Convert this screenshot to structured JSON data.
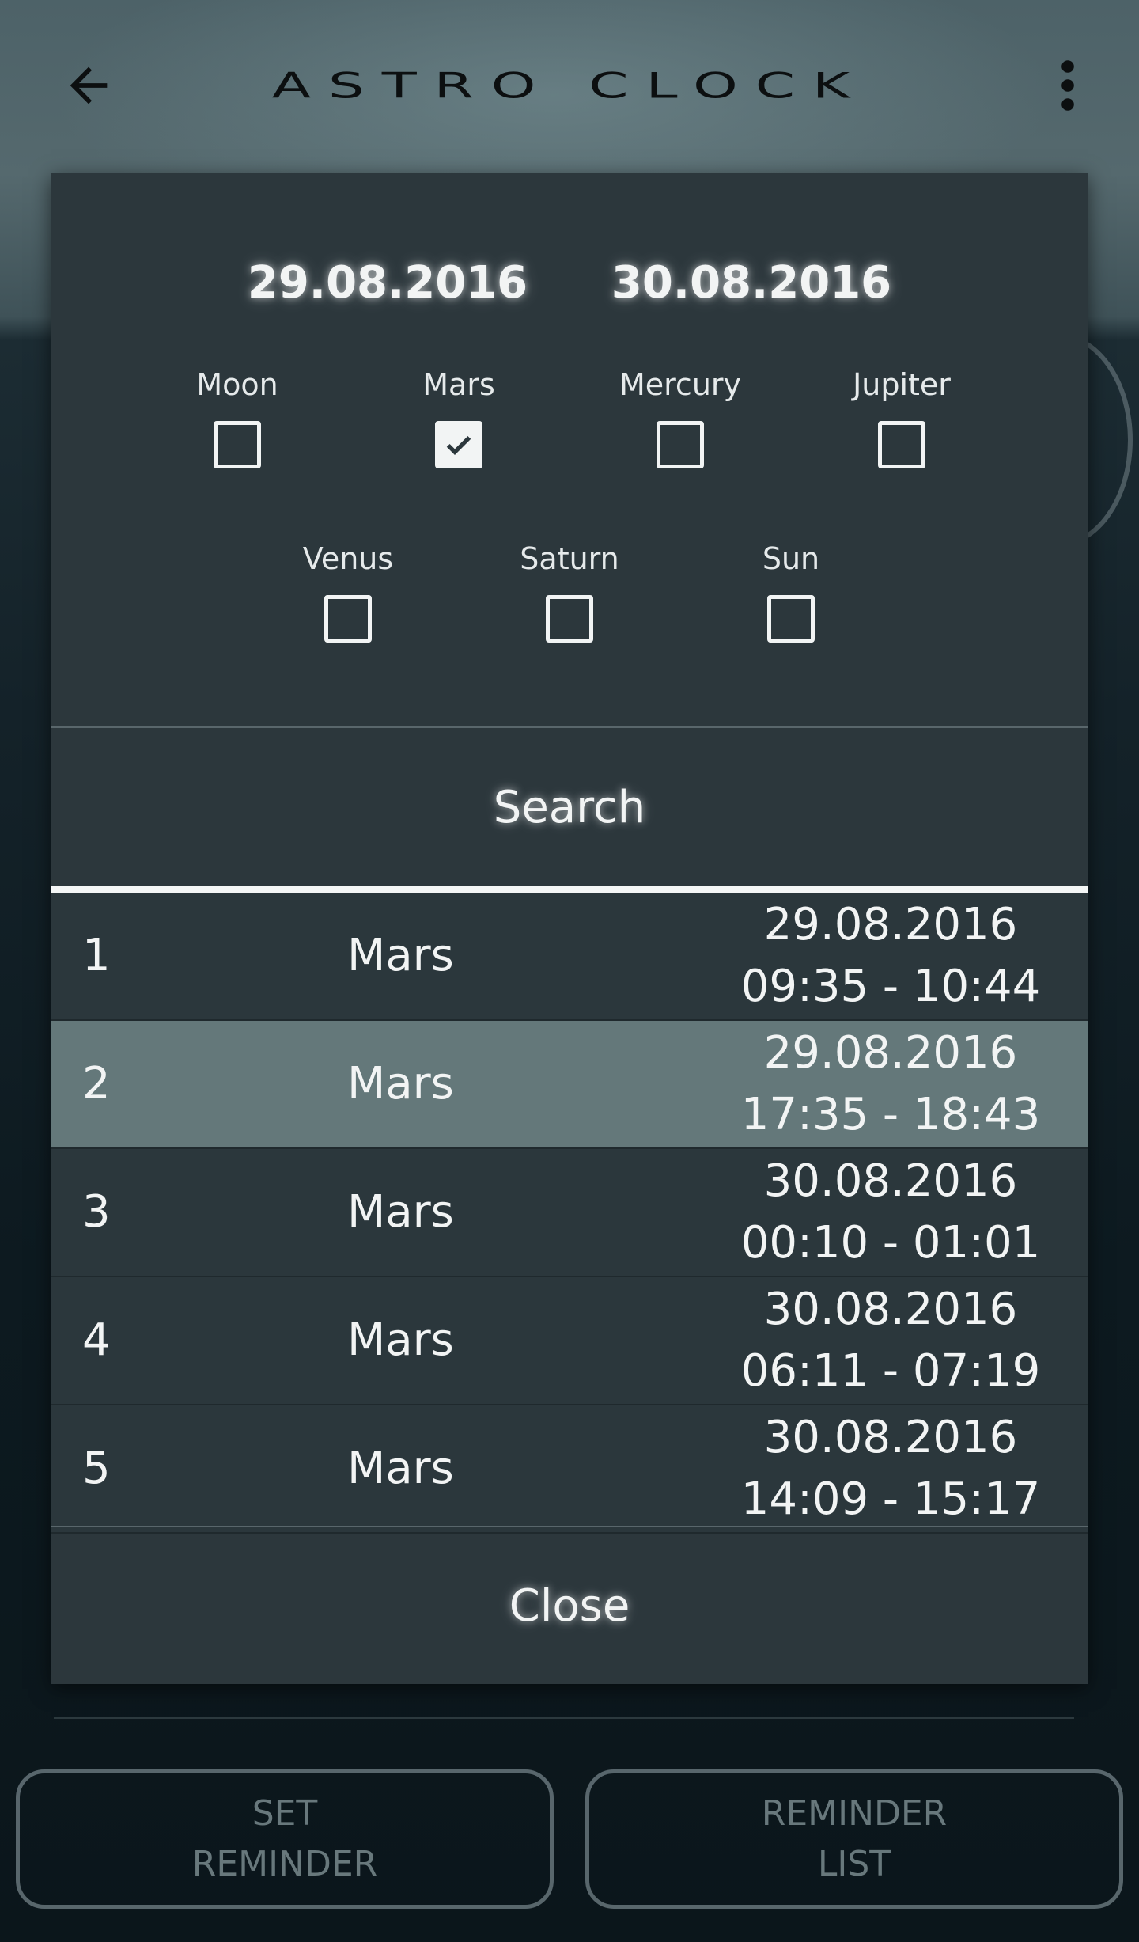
{
  "app": {
    "title": "ASTRO CLOCK",
    "icons": {
      "back": "arrow-left-icon",
      "menu": "more-vertical-icon"
    }
  },
  "background": {
    "bottom_buttons": {
      "set_reminder": "SET\nREMINDER",
      "reminder_list": "REMINDER\nLIST"
    }
  },
  "dialog": {
    "date_from": "29.08.2016",
    "date_to": "30.08.2016",
    "planets": [
      {
        "name": "Moon",
        "checked": false
      },
      {
        "name": "Mars",
        "checked": true
      },
      {
        "name": "Mercury",
        "checked": false
      },
      {
        "name": "Jupiter",
        "checked": false
      },
      {
        "name": "Venus",
        "checked": false
      },
      {
        "name": "Saturn",
        "checked": false
      },
      {
        "name": "Sun",
        "checked": false
      }
    ],
    "search_label": "Search",
    "results": [
      {
        "num": "1",
        "planet": "Mars",
        "date": "29.08.2016",
        "time": "09:35 - 10:44",
        "selected": false
      },
      {
        "num": "2",
        "planet": "Mars",
        "date": "29.08.2016",
        "time": "17:35 - 18:43",
        "selected": true
      },
      {
        "num": "3",
        "planet": "Mars",
        "date": "30.08.2016",
        "time": "00:10 - 01:01",
        "selected": false
      },
      {
        "num": "4",
        "planet": "Mars",
        "date": "30.08.2016",
        "time": "06:11 - 07:19",
        "selected": false
      },
      {
        "num": "5",
        "planet": "Mars",
        "date": "30.08.2016",
        "time": "14:09 - 15:17",
        "selected": false
      }
    ],
    "close_label": "Close"
  },
  "colors": {
    "dialog_bg": "#2c373c",
    "selected_row": "#64787a",
    "text": "#f2f4f4"
  }
}
